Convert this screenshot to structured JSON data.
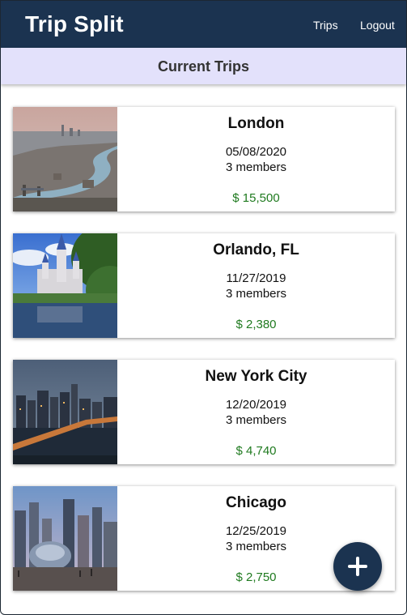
{
  "app": {
    "title": "Trip Split"
  },
  "nav": {
    "trips_label": "Trips",
    "logout_label": "Logout"
  },
  "page": {
    "heading": "Current Trips"
  },
  "trips": [
    {
      "city": "London",
      "date": "05/08/2020",
      "members": "3 members",
      "amount": "$ 15,500",
      "image": "london-skyline-photo"
    },
    {
      "city": "Orlando, FL",
      "date": "11/27/2019",
      "members": "3 members",
      "amount": "$ 2,380",
      "image": "castle-photo"
    },
    {
      "city": "New York City",
      "date": "12/20/2019",
      "members": "3 members",
      "amount": "$ 4,740",
      "image": "nyc-night-photo"
    },
    {
      "city": "Chicago",
      "date": "12/25/2019",
      "members": "3 members",
      "amount": "$ 2,750",
      "image": "chicago-bean-photo"
    }
  ],
  "fab": {
    "icon": "plus-icon"
  },
  "colors": {
    "navbar": "#1b3350",
    "subheader": "#e3e1fb",
    "amount": "#1f7a1f"
  }
}
